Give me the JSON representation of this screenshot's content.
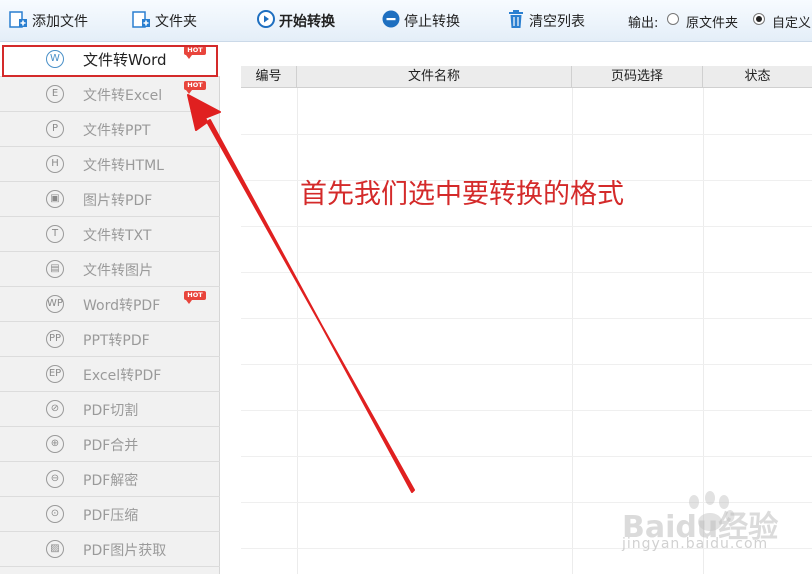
{
  "toolbar": {
    "add_file": "添加文件",
    "folder": "文件夹",
    "start": "开始转换",
    "stop": "停止转换",
    "clear": "清空列表",
    "output_label": "输出:",
    "output_options": [
      {
        "label": "原文件夹",
        "checked": false
      },
      {
        "label": "自定义",
        "checked": true
      }
    ]
  },
  "sidebar": {
    "items": [
      {
        "icon": "W",
        "label": "文件转Word",
        "hot": true,
        "active": true
      },
      {
        "icon": "E",
        "label": "文件转Excel",
        "hot": true,
        "active": false
      },
      {
        "icon": "P",
        "label": "文件转PPT",
        "hot": false,
        "active": false
      },
      {
        "icon": "H",
        "label": "文件转HTML",
        "hot": false,
        "active": false
      },
      {
        "icon": "▣",
        "label": "图片转PDF",
        "hot": false,
        "active": false
      },
      {
        "icon": "T",
        "label": "文件转TXT",
        "hot": false,
        "active": false
      },
      {
        "icon": "▤",
        "label": "文件转图片",
        "hot": false,
        "active": false
      },
      {
        "icon": "WP",
        "label": "Word转PDF",
        "hot": true,
        "active": false
      },
      {
        "icon": "PP",
        "label": "PPT转PDF",
        "hot": false,
        "active": false
      },
      {
        "icon": "EP",
        "label": "Excel转PDF",
        "hot": false,
        "active": false
      },
      {
        "icon": "⊘",
        "label": "PDF切割",
        "hot": false,
        "active": false
      },
      {
        "icon": "⊕",
        "label": "PDF合并",
        "hot": false,
        "active": false
      },
      {
        "icon": "⊖",
        "label": "PDF解密",
        "hot": false,
        "active": false
      },
      {
        "icon": "⊙",
        "label": "PDF压缩",
        "hot": false,
        "active": false
      },
      {
        "icon": "▨",
        "label": "PDF图片获取",
        "hot": false,
        "active": false
      }
    ],
    "hot_badge": "HOT"
  },
  "table": {
    "columns": [
      "编号",
      "文件名称",
      "页码选择",
      "状态"
    ]
  },
  "annotation": {
    "text": "首先我们选中要转换的格式",
    "color": "#d42a2a"
  },
  "watermark": {
    "brand": "Baidu经验",
    "url": "jingyan.baidu.com"
  },
  "colors": {
    "accent": "#2a7fd0",
    "highlight": "#d42a2a",
    "hot_badge": "#e8453c"
  }
}
